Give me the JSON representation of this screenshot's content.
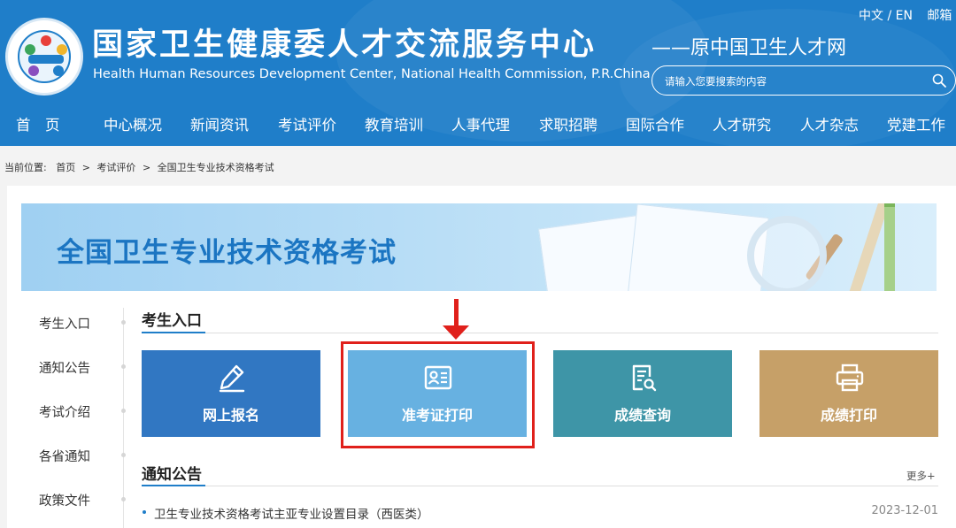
{
  "colors": {
    "header_blue": "#1f7ec9",
    "tile_signup": "#3177c2",
    "tile_admission": "#67b1e1",
    "tile_score_query": "#3e95a7",
    "tile_score_print": "#c6a068",
    "highlight_red": "#e0201b"
  },
  "header": {
    "title_cn": "国家卫生健康委人才交流服务中心",
    "title_en": "Health Human Resources Development Center, National Health Commission, P.R.China",
    "subtitle": "——原中国卫生人才网",
    "lang_switch": "中文 / EN",
    "mail": "邮箱",
    "search_placeholder": "请输入您要搜索的内容",
    "search_icon": "search-icon",
    "logo": "organization-logo"
  },
  "nav": {
    "items": [
      "首　页",
      "中心概况",
      "新闻资讯",
      "考试评价",
      "教育培训",
      "人事代理",
      "求职招聘",
      "国际合作",
      "人才研究",
      "人才杂志",
      "党建工作"
    ]
  },
  "breadcrumb": {
    "label": "当前位置:",
    "items": [
      "首页",
      "考试评价",
      "全国卫生专业技术资格考试"
    ],
    "separator": ">"
  },
  "banner": {
    "title": "全国卫生专业技术资格考试"
  },
  "sidebar": {
    "items": [
      "考生入口",
      "通知公告",
      "考试介绍",
      "各省通知",
      "政策文件"
    ]
  },
  "entrance": {
    "title": "考生入口",
    "tiles": [
      {
        "label": "网上报名",
        "icon": "pencil-edit-icon"
      },
      {
        "label": "准考证打印",
        "icon": "id-card-icon"
      },
      {
        "label": "成绩查询",
        "icon": "document-search-icon"
      },
      {
        "label": "成绩打印",
        "icon": "printer-icon"
      }
    ]
  },
  "notices": {
    "title": "通知公告",
    "more": "更多+",
    "items": [
      {
        "title": "卫生专业技术资格考试主亚专业设置目录（西医类）",
        "date": "2023-12-01"
      }
    ]
  }
}
